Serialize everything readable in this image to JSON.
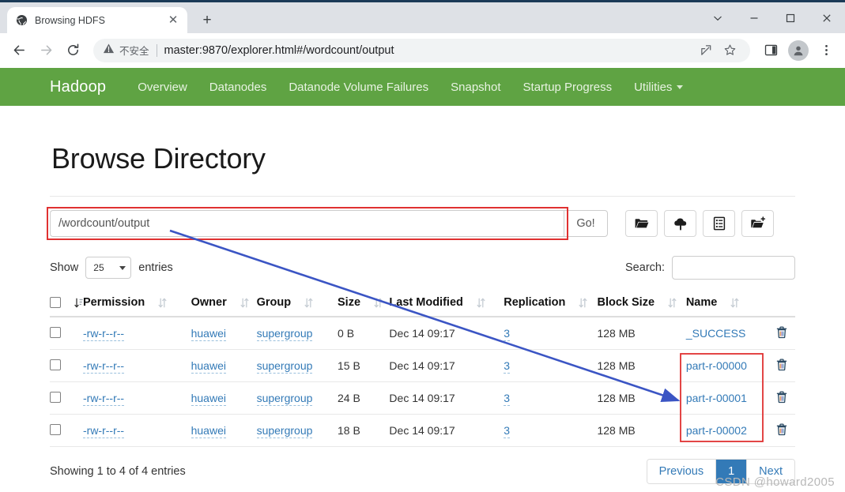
{
  "browser": {
    "tab": {
      "title": "Browsing HDFS",
      "favicon": "globe-icon",
      "close": "✕"
    },
    "new_tab": "+",
    "window_controls": {
      "collapse": "⌄",
      "minimize": "—",
      "maximize": "□",
      "close": "✕"
    },
    "nav": {
      "back": "←",
      "forward": "→",
      "reload": "⟳"
    },
    "omnibox": {
      "security_label": "不安全",
      "security_icon": "warning-triangle-icon",
      "url": "master:9870/explorer.html#/wordcount/output"
    }
  },
  "navbar": {
    "brand": "Hadoop",
    "links": [
      {
        "label": "Overview"
      },
      {
        "label": "Datanodes"
      },
      {
        "label": "Datanode Volume Failures"
      },
      {
        "label": "Snapshot"
      },
      {
        "label": "Startup Progress"
      },
      {
        "label": "Utilities",
        "dropdown": true
      }
    ]
  },
  "page": {
    "title": "Browse Directory",
    "path_value": "/wordcount/output",
    "go_label": "Go!",
    "toolbar_icons": [
      "folder-icon",
      "upload-cloud-icon",
      "clipboard-list-icon",
      "new-folder-icon"
    ]
  },
  "table_controls": {
    "show_label": "Show",
    "entries_label": "entries",
    "page_size": "25",
    "search_label": "Search:",
    "search_value": ""
  },
  "table": {
    "columns": [
      "Permission",
      "Owner",
      "Group",
      "Size",
      "Last Modified",
      "Replication",
      "Block Size",
      "Name"
    ],
    "rows": [
      {
        "permission": "-rw-r--r--",
        "owner": "huawei",
        "group": "supergroup",
        "size": "0 B",
        "modified": "Dec 14 09:17",
        "replication": "3",
        "block_size": "128 MB",
        "name": "_SUCCESS"
      },
      {
        "permission": "-rw-r--r--",
        "owner": "huawei",
        "group": "supergroup",
        "size": "15 B",
        "modified": "Dec 14 09:17",
        "replication": "3",
        "block_size": "128 MB",
        "name": "part-r-00000"
      },
      {
        "permission": "-rw-r--r--",
        "owner": "huawei",
        "group": "supergroup",
        "size": "24 B",
        "modified": "Dec 14 09:17",
        "replication": "3",
        "block_size": "128 MB",
        "name": "part-r-00001"
      },
      {
        "permission": "-rw-r--r--",
        "owner": "huawei",
        "group": "supergroup",
        "size": "18 B",
        "modified": "Dec 14 09:17",
        "replication": "3",
        "block_size": "128 MB",
        "name": "part-r-00002"
      }
    ]
  },
  "footer": {
    "showing": "Showing 1 to 4 of 4 entries",
    "previous": "Previous",
    "page_1": "1",
    "next": "Next"
  },
  "watermark": "CSDN @howard2005",
  "colors": {
    "hadoop_green": "#5fa343",
    "link_blue": "#337ab7",
    "annotation_red": "#e03131",
    "annotation_blue": "#3b55c4"
  }
}
